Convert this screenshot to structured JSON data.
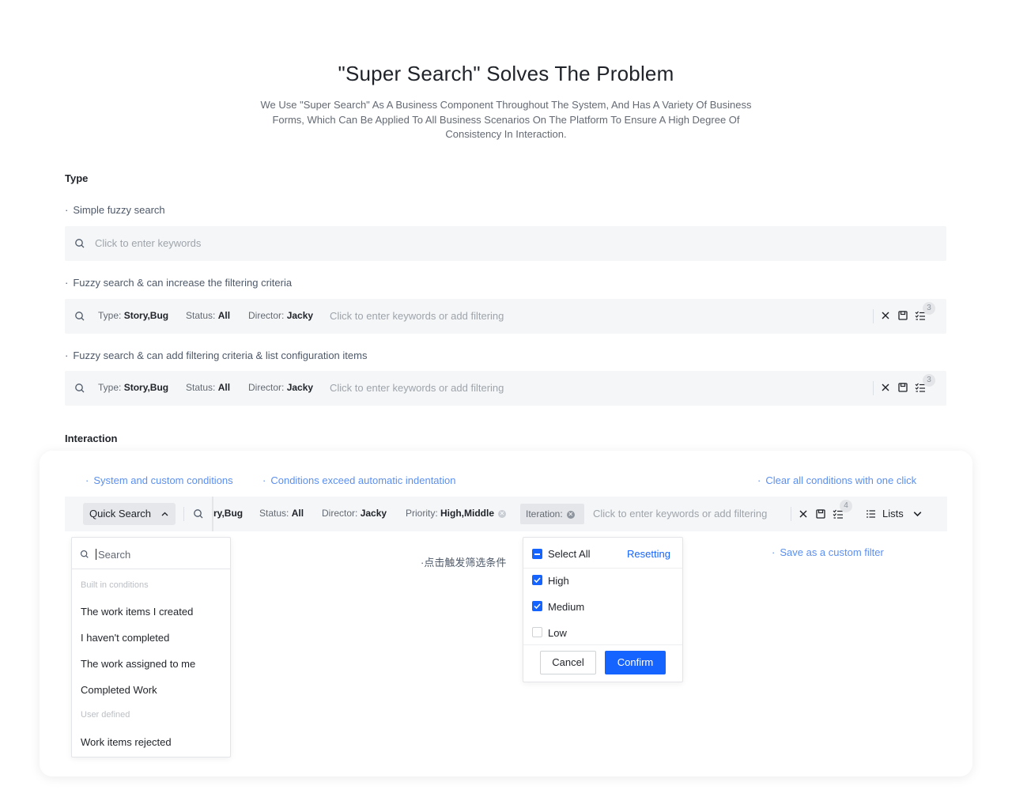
{
  "header": {
    "title": "\"Super Search\" Solves The Problem",
    "subtitle_line1": "We Use \"Super Search\" As A Business Component Throughout The System, And Has A Variety Of Business",
    "subtitle_line2": "Forms, Which Can Be Applied To All Business Scenarios On The Platform To Ensure A High Degree Of",
    "subtitle_line3": "Consistency In Interaction."
  },
  "type_section": {
    "heading": "Type",
    "simple": {
      "label": "Simple fuzzy search",
      "placeholder": "Click to enter keywords"
    },
    "filter": {
      "label": "Fuzzy search & can increase the filtering criteria",
      "conditions": [
        {
          "key": "Type: ",
          "value": "Story,Bug"
        },
        {
          "key": "Status: ",
          "value": "All"
        },
        {
          "key": "Director: ",
          "value": "Jacky"
        }
      ],
      "placeholder": "Click to enter keywords or add filtering",
      "badge": "3"
    },
    "config": {
      "label": "Fuzzy search & can add filtering criteria & list configuration items",
      "conditions": [
        {
          "key": "Type: ",
          "value": "Story,Bug"
        },
        {
          "key": "Status: ",
          "value": "All"
        },
        {
          "key": "Director: ",
          "value": "Jacky"
        }
      ],
      "placeholder": "Click to enter keywords or add filtering",
      "badge": "3"
    }
  },
  "interaction": {
    "heading": "Interaction",
    "annotations": {
      "system_custom": "System and custom conditions",
      "indent": "Conditions exceed automatic indentation",
      "clear_all": "Clear all conditions with one click",
      "trigger": "点击触发筛选条件",
      "save_filter": "Save as a custom filter"
    },
    "bar": {
      "quick_search": "Quick Search",
      "truncated": "ry,Bug",
      "conditions": [
        {
          "key": "Status: ",
          "value": "All"
        },
        {
          "key": "Director: ",
          "value": "Jacky"
        },
        {
          "key": "Priority: ",
          "value": "High,Middle"
        }
      ],
      "iteration": "Iteration:",
      "placeholder": "Click to enter keywords or add filtering",
      "badge": "4",
      "view": "Lists"
    },
    "dropdown": {
      "search_placeholder": "Search",
      "built_in_heading": "Built in conditions",
      "built_in": [
        "The work items I created",
        "I haven't completed",
        "The work assigned to me",
        "Completed Work"
      ],
      "user_heading": "User defined",
      "user_items": [
        "Work items rejected"
      ]
    },
    "check_panel": {
      "select_all": "Select All",
      "resetting": "Resetting",
      "options": [
        {
          "label": "High",
          "checked": true
        },
        {
          "label": "Medium",
          "checked": true
        },
        {
          "label": "Low",
          "checked": false
        }
      ],
      "cancel": "Cancel",
      "confirm": "Confirm"
    }
  },
  "colors": {
    "primary": "#1664ff",
    "annotation": "#5b8ff0",
    "bar_bg": "#f5f6f7"
  }
}
